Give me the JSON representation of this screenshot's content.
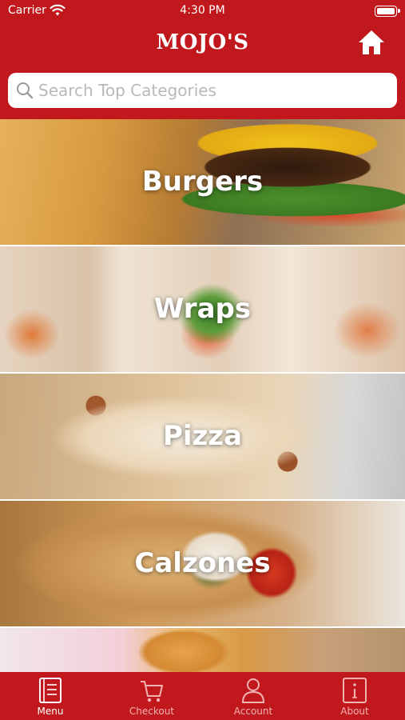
{
  "status_bar": {
    "carrier": "Carrier",
    "time": "4:30 PM"
  },
  "header": {
    "brand": "MOJO'S",
    "home_icon": "home-icon"
  },
  "search": {
    "placeholder": "Search Top Categories",
    "icon": "search-icon"
  },
  "categories": [
    {
      "label": "Burgers"
    },
    {
      "label": "Wraps"
    },
    {
      "label": "Pizza"
    },
    {
      "label": "Calzones"
    },
    {
      "label": ""
    }
  ],
  "tabs": [
    {
      "label": "Menu",
      "icon": "menu-book-icon",
      "active": true
    },
    {
      "label": "Checkout",
      "icon": "cart-icon",
      "active": false
    },
    {
      "label": "Account",
      "icon": "user-icon",
      "active": false
    },
    {
      "label": "About",
      "icon": "info-icon",
      "active": false
    }
  ],
  "colors": {
    "brand_red": "#c0181c",
    "inactive_tab_label": "#f2b2b2"
  }
}
